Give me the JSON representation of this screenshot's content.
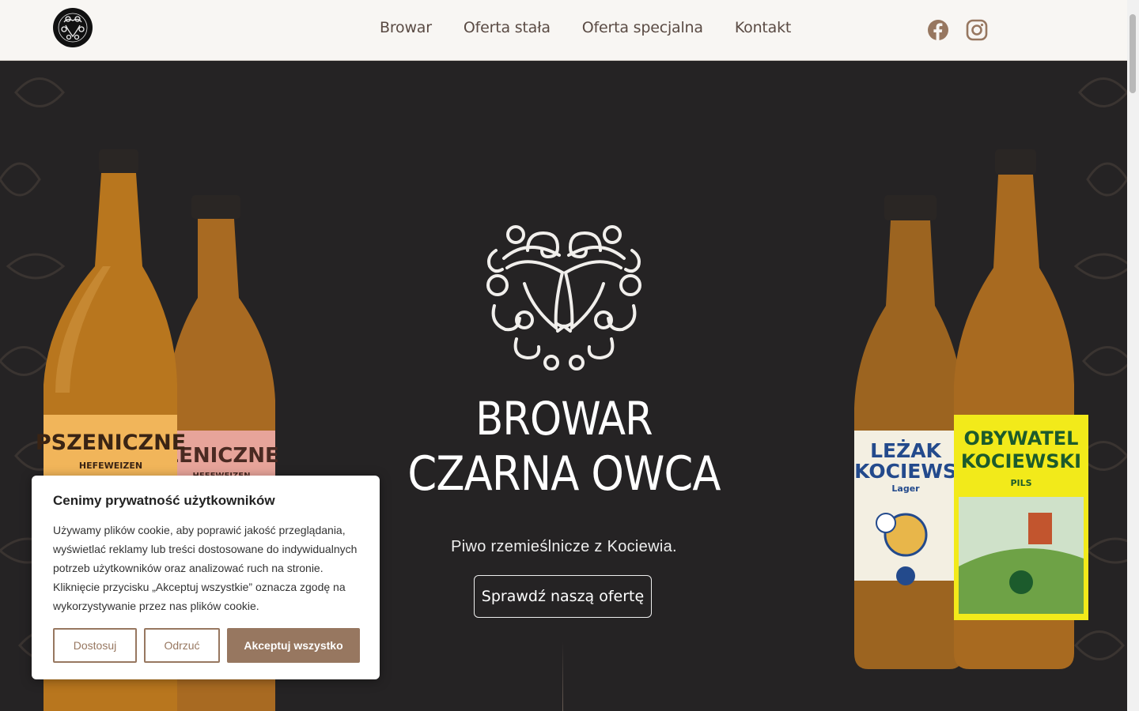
{
  "nav": {
    "links": [
      "Browar",
      "Oferta stała",
      "Oferta specjalna",
      "Kontakt"
    ],
    "social": [
      "facebook-icon",
      "instagram-icon"
    ]
  },
  "hero": {
    "title_line1": "BROWAR",
    "title_line2": "CZARNA OWCA",
    "tagline": "Piwo rzemieślnicze z Kociewia.",
    "cta": "Sprawdź naszą ofertę"
  },
  "bottles": {
    "left_front": {
      "name": "PSZENICZNE",
      "style": "HEFEWEIZEN"
    },
    "left_back": {
      "name": "ZENICZNE",
      "style": "HEFEWEIZEN"
    },
    "right_back": {
      "name_line1": "LEŻAK",
      "name_line2": "KOCIEWS",
      "style": "Lager"
    },
    "right_front": {
      "name_line1": "OBYWATEL",
      "name_line2": "KOCIEWSKI",
      "style": "PILS"
    }
  },
  "cookie": {
    "title": "Cenimy prywatność użytkowników",
    "text": "Używamy plików cookie, aby poprawić jakość przeglądania, wyświetlać reklamy lub treści dostosowane do indywidualnych potrzeb użytkowników oraz analizować ruch na stronie. Kliknięcie przycisku „Akceptuj wszystkie” oznacza zgodę na wykorzystywanie przez nas plików cookie.",
    "buttons": [
      "Dostosuj",
      "Odrzuć",
      "Akceptuj wszystko"
    ]
  },
  "colors": {
    "accent": "#977760",
    "nav_bg": "#f8f6f3",
    "hero_bg": "#252324"
  }
}
